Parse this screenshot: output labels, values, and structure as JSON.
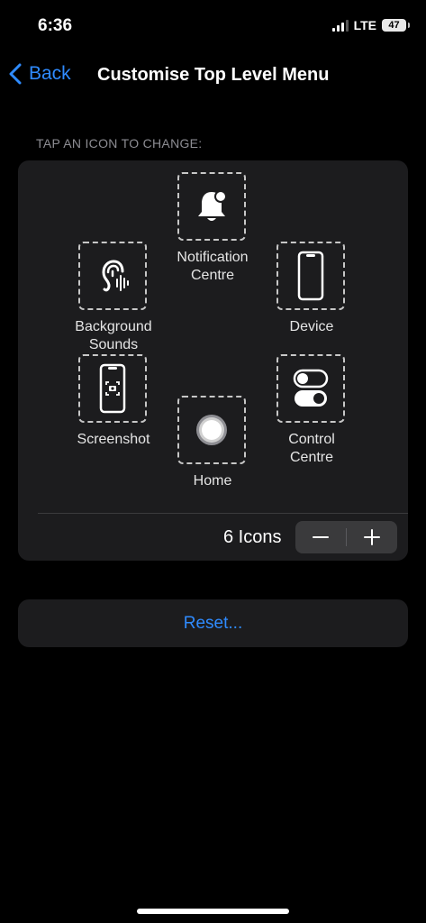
{
  "status_bar": {
    "time": "6:36",
    "network": "LTE",
    "battery": "47"
  },
  "nav": {
    "back_label": "Back",
    "title": "Customise Top Level Menu"
  },
  "section_label": "TAP AN ICON TO CHANGE:",
  "icons": {
    "notification": {
      "label_line1": "Notification",
      "label_line2": "Centre",
      "icon": "bell-icon"
    },
    "background_sounds": {
      "label_line1": "Background",
      "label_line2": "Sounds",
      "icon": "ear-icon"
    },
    "device": {
      "label": "Device",
      "icon": "phone-icon"
    },
    "screenshot": {
      "label": "Screenshot",
      "icon": "screenshot-icon"
    },
    "control_centre": {
      "label_line1": "Control",
      "label_line2": "Centre",
      "icon": "toggles-icon"
    },
    "home": {
      "label": "Home",
      "icon": "home-button-icon"
    }
  },
  "icon_count_label": "6 Icons",
  "reset_label": "Reset...",
  "colors": {
    "accent": "#2f8bff",
    "card": "#1c1c1e",
    "background": "#000000"
  }
}
